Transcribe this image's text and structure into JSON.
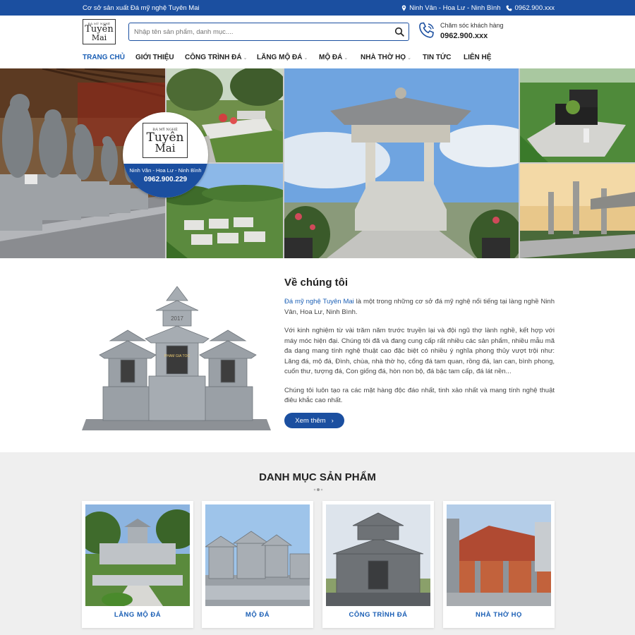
{
  "topbar": {
    "tagline": "Cơ sở sản xuất Đá mỹ nghệ Tuyên Mai",
    "address": "Ninh Vân - Hoa Lư - Ninh Bình",
    "phone": "0962.900.xxx"
  },
  "header": {
    "logo": {
      "top": "ĐÁ MỸ NGHỆ",
      "line1": "Tuyên",
      "line2": "Mai"
    },
    "search_placeholder": "Nhập tên sản phẩm, danh mục....",
    "hotline_label": "Chăm sóc khách hàng",
    "hotline_number": "0962.900.xxx"
  },
  "nav": [
    {
      "label": "TRANG CHỦ",
      "active": true,
      "dropdown": false
    },
    {
      "label": "GIỚI THIỆU",
      "active": false,
      "dropdown": false
    },
    {
      "label": "CÔNG TRÌNH ĐÁ",
      "active": false,
      "dropdown": true
    },
    {
      "label": "LĂNG MỘ ĐÁ",
      "active": false,
      "dropdown": true
    },
    {
      "label": "MỘ ĐÁ",
      "active": false,
      "dropdown": true
    },
    {
      "label": "NHÀ THỜ HỌ",
      "active": false,
      "dropdown": true
    },
    {
      "label": "TIN TỨC",
      "active": false,
      "dropdown": false
    },
    {
      "label": "LIÊN HỆ",
      "active": false,
      "dropdown": false
    }
  ],
  "banner": {
    "badge_address": "Ninh Vân - Hoa Lư - Ninh Bình",
    "badge_phone": "0962.900.229"
  },
  "about": {
    "title": "Về chúng tôi",
    "p1_brand": "Đá mỹ nghệ Tuyên Mai",
    "p1_rest": " là một trong những cơ sở đá mỹ nghệ nổi tiếng tại làng nghề Ninh Vân, Hoa Lư, Ninh Bình.",
    "p2": "Với kinh nghiệm từ vài trăm năm trước truyền lại và đội ngũ thợ lành nghề, kết hợp với máy móc hiện đại. Chúng tôi đã và đang cung cấp rất nhiều các sản phẩm, nhiều mẫu mã đa dạng mang tính nghệ thuật cao đặc biệt có nhiều ý nghĩa phong thủy vượt trội như: Lăng đá, mộ đá, Đình, chùa, nhà thờ họ, cổng đá tam quan, rồng đá, lan can, bình phong, cuốn thư, tượng đá, Con giống đá, hòn non bộ, đá bậc tam cấp, đá lát nền...",
    "p3": "Chúng tôi luôn tạo ra các mặt hàng độc đáo nhất, tinh xảo nhất và mang tính nghệ thuật điêu khắc cao nhất.",
    "button": "Xem thêm",
    "shrine_year": "2017",
    "shrine_plaque": "PHAM GIA TOC"
  },
  "categories": {
    "title": "DANH MỤC SẢN PHẨM",
    "items": [
      {
        "label": "LĂNG MỘ ĐÁ"
      },
      {
        "label": "MỘ ĐÁ"
      },
      {
        "label": "CÔNG TRÌNH ĐÁ"
      },
      {
        "label": "NHÀ THỜ HỌ"
      }
    ]
  },
  "colors": {
    "primary": "#1b4fa0",
    "link": "#1b5fb5",
    "section_bg": "#efefef"
  }
}
